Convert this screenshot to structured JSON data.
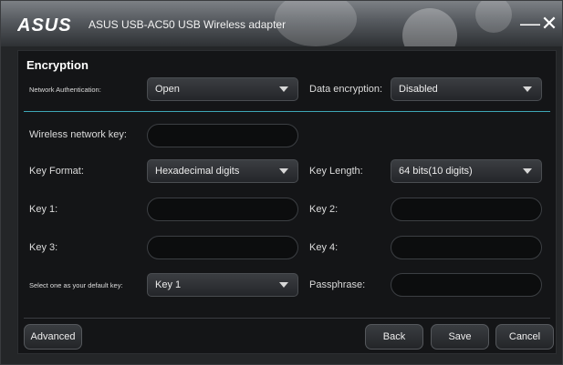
{
  "window": {
    "brand": "ASUS",
    "title": "ASUS USB-AC50 USB Wireless adapter",
    "minimize_glyph": "—",
    "close_glyph": "✕"
  },
  "encryption": {
    "section_title": "Encryption",
    "network_auth_label": "Network Authentication:",
    "network_auth_value": "Open",
    "data_encryption_label": "Data encryption:",
    "data_encryption_value": "Disabled",
    "wireless_key_label": "Wireless network key:",
    "wireless_key_value": "",
    "key_format_label": "Key Format:",
    "key_format_value": "Hexadecimal digits",
    "key_length_label": "Key Length:",
    "key_length_value": "64 bits(10 digits)",
    "key1_label": "Key 1:",
    "key1_value": "",
    "key2_label": "Key 2:",
    "key2_value": "",
    "key3_label": "Key 3:",
    "key3_value": "",
    "key4_label": "Key 4:",
    "key4_value": "",
    "default_key_label": "Select one as your default key:",
    "default_key_value": "Key 1",
    "passphrase_label": "Passphrase:",
    "passphrase_value": ""
  },
  "buttons": {
    "advanced": "Advanced",
    "back": "Back",
    "save": "Save",
    "cancel": "Cancel"
  },
  "colors": {
    "accent_divider": "#3ea6b6",
    "background": "#141517"
  }
}
